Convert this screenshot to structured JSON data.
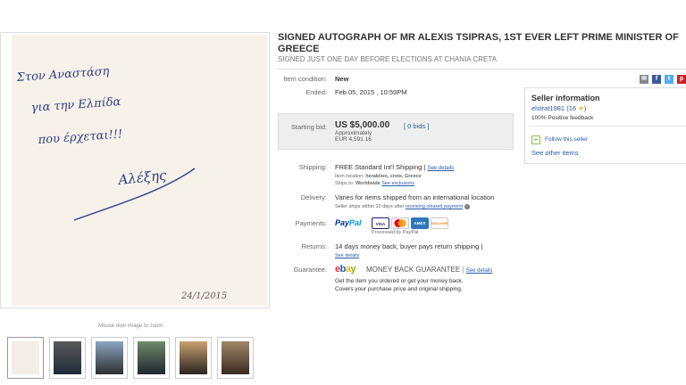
{
  "listing": {
    "title": "SIGNED AUTOGRAPH OF MR ALEXIS TSIPRAS, 1ST EVER LEFT PRIME MINISTER OF GREECE",
    "subtitle": "SIGNED JUST ONE DAY BEFORE ELECTIONS AT CHANIA CRETA"
  },
  "image": {
    "handwriting_line1": "Στον Αναστάση",
    "handwriting_line2": "για την Ελπίδα",
    "handwriting_line3": "που έρχεται!!!",
    "signature": "Αλέξης",
    "date": "24/1/2015",
    "zoom_hint": "Mouse over image to zoom"
  },
  "details": {
    "condition_label": "Item condition:",
    "condition_value": "New",
    "ended_label": "Ended:",
    "ended_value": "Feb 05, 2015 , 10:59PM",
    "starting_bid_label": "Starting bid:",
    "starting_bid_value": "US $5,000.00",
    "approx_label": "Approximately",
    "approx_value": "EUR 4,591.16",
    "bids": "[ 0 bids ]",
    "shipping_label": "Shipping:",
    "shipping_value": "FREE  Standard Int'l Shipping |",
    "shipping_link": "See details",
    "item_location_label": "Item location:",
    "item_location_value": "heraklion, crete, Greece",
    "ships_to_label": "Ships to:",
    "ships_to_value": "Worldwide",
    "see_exclusions": "See exclusions",
    "delivery_label": "Delivery:",
    "delivery_value": "Varies for items shipped from an international location",
    "delivery_note": "Seller ships within 10 days after",
    "delivery_link": "receiving cleared payment",
    "payments_label": "Payments:",
    "processed_by": "Processed by PayPal",
    "returns_label": "Returns:",
    "returns_value": "14 days money back, buyer pays return shipping |",
    "returns_link": "See details",
    "guarantee_label": "Guarantee:",
    "guarantee_brand": "MONEY BACK GUARANTEE",
    "guarantee_link": "See details",
    "guarantee_line1": "Get the item you ordered or get your money back.",
    "guarantee_line2": "Covers your purchase price and original shipping."
  },
  "payments": {
    "paypal_1": "Pay",
    "paypal_2": "Pal",
    "cards": [
      "VISA",
      "MC",
      "AMEX",
      "DISCOVER"
    ]
  },
  "seller": {
    "title": "Seller information",
    "name": "elstrat1981 (16",
    "feedback": "100% Positive feedback",
    "follow": "Follow this seller",
    "other_items": "See other items"
  },
  "share_icons": [
    "email-icon",
    "facebook-icon",
    "twitter-icon",
    "pinterest-icon"
  ],
  "colors": {
    "link": "#2a5aa8",
    "paypal_dark": "#003087",
    "paypal_light": "#009cde",
    "ebay_e": "#e53238",
    "ebay_b": "#0064d2",
    "ebay_a": "#f5af02",
    "ebay_y": "#86b817"
  }
}
